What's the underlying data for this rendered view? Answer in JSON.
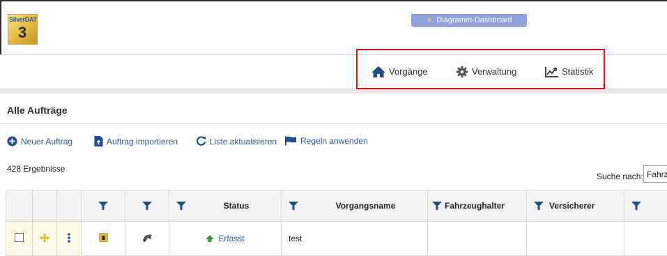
{
  "app": {
    "logo_text": "SilverDAT",
    "logo_number": "3"
  },
  "dashboard_tab": {
    "label": "Diagramm-Dashboard"
  },
  "nav": {
    "items": [
      {
        "label": "Vorgänge",
        "icon": "home-icon"
      },
      {
        "label": "Verwaltung",
        "icon": "gear-icon"
      },
      {
        "label": "Statistik",
        "icon": "chart-icon"
      }
    ]
  },
  "section": {
    "title": "Alle Aufträge"
  },
  "actions": {
    "new_order": "Neuer Auftrag",
    "import_order": "Auftrag importieren",
    "refresh_list": "Liste aktualisieren",
    "apply_rules": "Regeln anwenden"
  },
  "results": {
    "count_text": "428 Ergebnisse"
  },
  "search": {
    "label": "Suche nach:",
    "value": "Fahrz"
  },
  "table": {
    "headers": {
      "status": "Status",
      "vorgangsname": "Vorgangsname",
      "fahrzeughalter": "Fahrzeughalter",
      "versicherer": "Versicherer"
    },
    "rows": [
      {
        "status": "Erfasst",
        "vorgangsname": "test",
        "fahrzeughalter": "",
        "versicherer": ""
      }
    ]
  },
  "colors": {
    "accent": "#2a5d9e",
    "highlight_border": "#e01010",
    "dash_tab": "#8ea2dd"
  }
}
